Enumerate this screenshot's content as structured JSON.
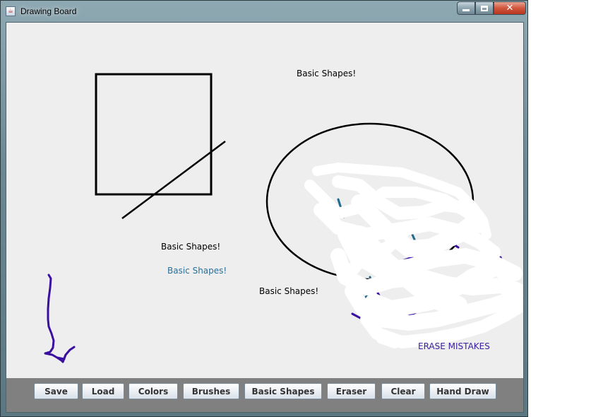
{
  "window": {
    "title": "Drawing Board",
    "icon": "java-app-icon",
    "controls": {
      "minimize": "minimize-icon",
      "maximize": "maximize-icon",
      "close": "✕"
    }
  },
  "canvas": {
    "background": "#eeeeee",
    "texts": [
      {
        "text": "Basic Shapes!",
        "color": "#000000"
      },
      {
        "text": "Basic Shapes!",
        "color": "#000000"
      },
      {
        "text": "Basic Shapes!",
        "color": "#2a6f97"
      },
      {
        "text": "Basic Shapes!",
        "color": "#000000"
      },
      {
        "text": "ERASE MISTAKES",
        "color": "#3a1f9e"
      }
    ],
    "shapes": [
      "square",
      "diagonal-line",
      "ellipse",
      "freehand-arrow",
      "eraser-strokes"
    ],
    "stroke_colors": {
      "shape": "#000000",
      "freehand": "#3a0fa0",
      "accent": "#1f6b8f",
      "eraser": "#ffffff"
    }
  },
  "toolbar": {
    "buttons": [
      "Save",
      "Load",
      "Colors",
      "Brushes",
      "Basic Shapes",
      "Eraser",
      "Clear",
      "Hand Draw"
    ]
  }
}
